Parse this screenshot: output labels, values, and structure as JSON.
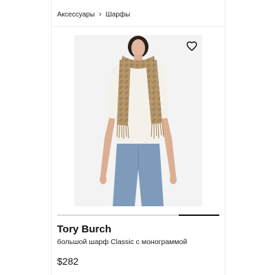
{
  "breadcrumb": {
    "items": [
      "Аксессуары",
      "Шарфы"
    ],
    "separator": "›"
  },
  "product": {
    "brand": "Tory Burch",
    "name": "большой шарф Classic с монограммой",
    "price": "$282"
  },
  "gallery": {
    "wishlist_icon": "heart-outline-icon",
    "image_progress": 0.25
  },
  "colors": {
    "background": "#ffffff",
    "image_bg": "#f3f3f3",
    "scarf": "#b39468",
    "sweater": "#f4f1ea",
    "jeans": "#7f9bbb",
    "progress_track": "#d9d9d9",
    "progress_fill": "#111111"
  }
}
